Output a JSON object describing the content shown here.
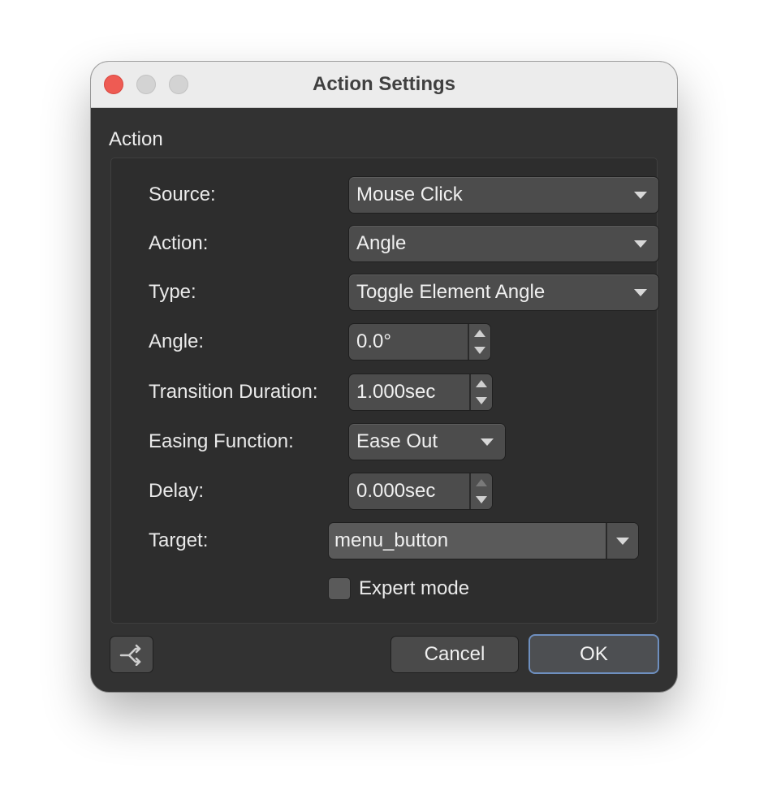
{
  "window": {
    "title": "Action Settings"
  },
  "section": {
    "label": "Action"
  },
  "fields": {
    "source": {
      "label": "Source:",
      "value": "Mouse Click"
    },
    "action": {
      "label": "Action:",
      "value": "Angle"
    },
    "type": {
      "label": "Type:",
      "value": "Toggle Element Angle"
    },
    "angle": {
      "label": "Angle:",
      "value": "0.0°"
    },
    "transition_duration": {
      "label": "Transition Duration:",
      "value": "1.000sec"
    },
    "easing_function": {
      "label": "Easing Function:",
      "value": "Ease Out"
    },
    "delay": {
      "label": "Delay:",
      "value": "0.000sec"
    },
    "target": {
      "label": "Target:",
      "value": "menu_button"
    }
  },
  "expert_mode": {
    "label": "Expert mode",
    "checked": false
  },
  "buttons": {
    "cancel": "Cancel",
    "ok": "OK"
  },
  "icons": {
    "close": "close-traffic-light",
    "minimize": "minimize-traffic-light",
    "maximize": "maximize-traffic-light",
    "dropdown": "chevron-down-icon",
    "stepper": "stepper-arrows-icon",
    "tool": "merge-arrows-icon"
  },
  "colors": {
    "close_red": "#ee5b53",
    "panel_bg": "#323232",
    "ok_focus": "#6e8fbf"
  }
}
